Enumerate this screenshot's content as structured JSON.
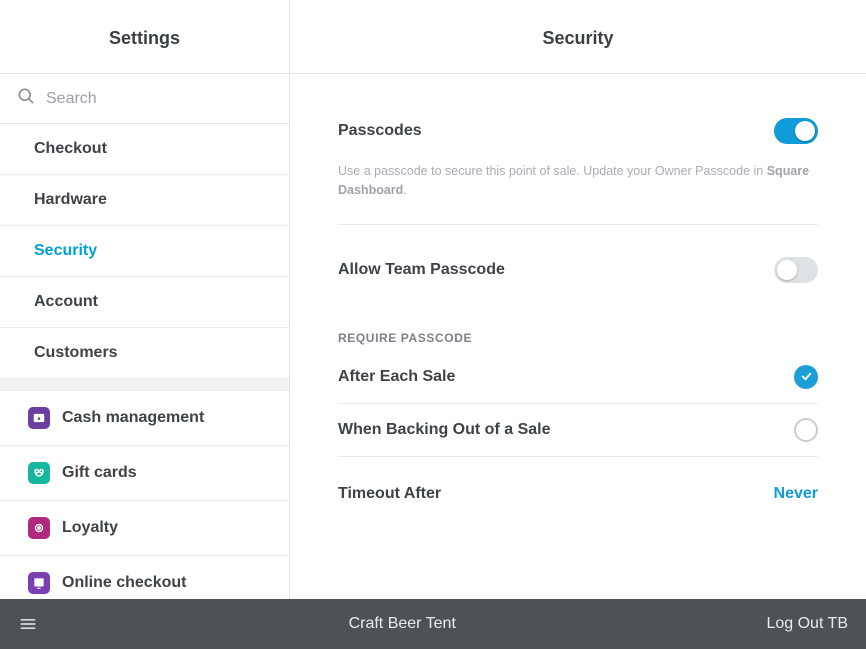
{
  "sidebar": {
    "title": "Settings",
    "search_placeholder": "Search",
    "items_top": [
      {
        "label": "Checkout",
        "active": false
      },
      {
        "label": "Hardware",
        "active": false
      },
      {
        "label": "Security",
        "active": true
      },
      {
        "label": "Account",
        "active": false
      },
      {
        "label": "Customers",
        "active": false
      }
    ],
    "items_bottom": [
      {
        "label": "Cash management",
        "icon": "cash",
        "icon_bg": "#6b3fa0"
      },
      {
        "label": "Gift cards",
        "icon": "gift",
        "icon_bg": "#15b79e"
      },
      {
        "label": "Loyalty",
        "icon": "loyalty",
        "icon_bg": "#b0297e"
      },
      {
        "label": "Online checkout",
        "icon": "online",
        "icon_bg": "#7a3fb3"
      }
    ]
  },
  "content": {
    "title": "Security",
    "passcodes": {
      "label": "Passcodes",
      "enabled": true,
      "hint_prefix": "Use a passcode to secure this point of sale. Update your Owner Passcode in ",
      "hint_link": "Square Dashboard",
      "hint_suffix": "."
    },
    "team_passcode": {
      "label": "Allow Team Passcode",
      "enabled": false
    },
    "require_section_title": "REQUIRE PASSCODE",
    "require_options": [
      {
        "label": "After Each Sale",
        "checked": true
      },
      {
        "label": "When Backing Out of a Sale",
        "checked": false
      }
    ],
    "timeout": {
      "label": "Timeout After",
      "value": "Never"
    }
  },
  "bottombar": {
    "location": "Craft Beer Tent",
    "logout_label": "Log Out TB"
  }
}
